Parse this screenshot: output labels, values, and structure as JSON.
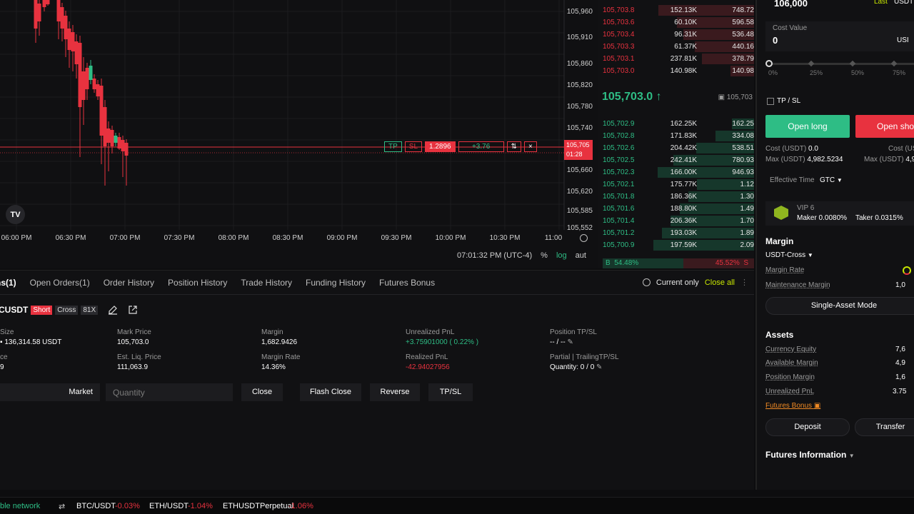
{
  "chart": {
    "price_labels": [
      "105,960",
      "105,910",
      "105,860",
      "105,820",
      "105,780",
      "105,740",
      "105,705",
      "105,660",
      "105,620",
      "105,585",
      "105,552"
    ],
    "time_labels": [
      "06:00 PM",
      "06:30 PM",
      "07:00 PM",
      "07:30 PM",
      "08:00 PM",
      "08:30 PM",
      "09:00 PM",
      "09:30 PM",
      "10:00 PM",
      "10:30 PM",
      "11:00"
    ],
    "current_price_tag": "105,705",
    "countdown": "01:28",
    "tv_logo": "TV",
    "order_line": {
      "tp": "TP",
      "sl": "SL",
      "qty": "1.2896",
      "pnl": "+3.76",
      "reverse_icon": "⇅",
      "close_icon": "×"
    },
    "footer": {
      "time": "07:01:32 PM (UTC-4)",
      "pct": "%",
      "log": "log",
      "auto": "aut"
    },
    "colors": {
      "up": "#2ebd85",
      "down": "#e8323f"
    }
  },
  "orderbook": {
    "asks": [
      {
        "price": "105,703.8",
        "size": "152.13K",
        "total": "748.72"
      },
      {
        "price": "105,703.6",
        "size": "60.10K",
        "total": "596.58"
      },
      {
        "price": "105,703.4",
        "size": "96.31K",
        "total": "536.48"
      },
      {
        "price": "105,703.3",
        "size": "61.37K",
        "total": "440.16"
      },
      {
        "price": "105,703.1",
        "size": "237.81K",
        "total": "378.79"
      },
      {
        "price": "105,703.0",
        "size": "140.98K",
        "total": "140.98"
      }
    ],
    "mid_price": "105,703.0 ↑",
    "mark_price": "105,703",
    "bids": [
      {
        "price": "105,702.9",
        "size": "162.25K",
        "total": "162.25"
      },
      {
        "price": "105,702.8",
        "size": "171.83K",
        "total": "334.08"
      },
      {
        "price": "105,702.6",
        "size": "204.42K",
        "total": "538.51"
      },
      {
        "price": "105,702.5",
        "size": "242.41K",
        "total": "780.93"
      },
      {
        "price": "105,702.3",
        "size": "166.00K",
        "total": "946.93"
      },
      {
        "price": "105,702.1",
        "size": "175.77K",
        "total": "1.12"
      },
      {
        "price": "105,701.8",
        "size": "186.36K",
        "total": "1.30"
      },
      {
        "price": "105,701.6",
        "size": "188.80K",
        "total": "1.49"
      },
      {
        "price": "105,701.4",
        "size": "206.36K",
        "total": "1.70"
      },
      {
        "price": "105,701.2",
        "size": "193.03K",
        "total": "1.89"
      },
      {
        "price": "105,700.9",
        "size": "197.59K",
        "total": "2.09"
      }
    ],
    "buy_label": "B",
    "buy_pct": "54.48%",
    "sell_pct": "45.52%",
    "sell_label": "S"
  },
  "tabs": [
    "ns(1)",
    "Open Orders(1)",
    "Order History",
    "Position History",
    "Trade History",
    "Funding History",
    "Futures Bonus"
  ],
  "tabs_right": {
    "current_only": "Current only",
    "close_all": "Close all",
    "more": "⋮"
  },
  "position": {
    "symbol": "CUSDT",
    "side": "Short",
    "margin_mode": "Cross",
    "leverage": "81X",
    "fields": {
      "size_label": "Size",
      "size_value": "136,314.58 USDT",
      "mark_label": "Mark Price",
      "mark_value": "105,703.0",
      "margin_label": "Margin",
      "margin_value": "1,682.9426",
      "upnl_label": "Unrealized PnL",
      "upnl_value": "+3.75901000 ( 0.22% )",
      "tpsl_label": "Position TP/SL",
      "tpsl_value": "-- / --",
      "price_label": "ce",
      "price_value": "9",
      "liq_label": "Est. Liq. Price",
      "liq_value": "111,063.9",
      "mrate_label": "Margin Rate",
      "mrate_value": "14.36%",
      "rpnl_label": "Realized PnL",
      "rpnl_value": "-42.94027956",
      "partial_label": "Partial | TrailingTP/SL",
      "partial_value": "Quantity: 0 / 0"
    },
    "actions": {
      "market": "Market",
      "qty_placeholder": "Quantity",
      "close": "Close",
      "flash_close": "Flash Close",
      "reverse": "Reverse",
      "tpsl": "TP/SL"
    }
  },
  "right": {
    "price_value": "106,000",
    "last_label": "Last",
    "unit_top": "USDT",
    "cost_label": "Cost Value",
    "cost_value": "0",
    "cost_unit": "USI",
    "pcts": [
      "0%",
      "25%",
      "50%",
      "75%"
    ],
    "tpsl": "TP / SL",
    "open_long": "Open long",
    "open_short": "Open shor",
    "cost_long_label": "Cost (USDT)",
    "cost_long_value": "0.0",
    "max_long_label": "Max (USDT)",
    "max_long_value": "4,982.5234",
    "cost_short_label": "Cost (US",
    "max_short_label": "Max (USDT)",
    "max_short_value": "4,9",
    "effective_label": "Effective Time",
    "effective_value": "GTC",
    "vip": "VIP 6",
    "maker": "Maker 0.0080%",
    "taker": "Taker 0.0315%",
    "margin_head": "Margin",
    "margin_mode": "USDT-Cross",
    "margin_rate_label": "Margin Rate",
    "maint_label": "Maintenance Margin",
    "maint_value": "1,0",
    "single_asset": "Single-Asset Mode",
    "assets_head": "Assets",
    "equity_label": "Currency Equity",
    "equity_value": "7,6",
    "avail_label": "Available Margin",
    "avail_value": "4,9",
    "posm_label": "Position Margin",
    "posm_value": "1,6",
    "upnl_label": "Unrealized PnL",
    "upnl_value": "3.75",
    "bonus_label": "Futures Bonus",
    "deposit": "Deposit",
    "transfer": "Transfer",
    "futures_info": "Futures Information"
  },
  "ticker": {
    "network": "ble network",
    "items": [
      {
        "sym": "BTC/USDT",
        "chg": "-0.03%"
      },
      {
        "sym": "ETH/USDT",
        "chg": "-1.04%"
      },
      {
        "sym": "ETHUSDTPerpetual",
        "chg": "-1.06%"
      }
    ]
  }
}
